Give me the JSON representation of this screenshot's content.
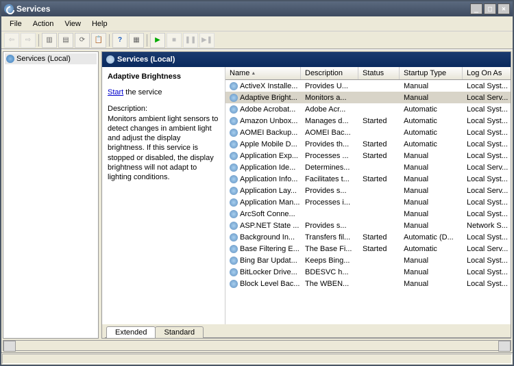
{
  "window": {
    "title": "Services"
  },
  "menu": [
    "File",
    "Action",
    "View",
    "Help"
  ],
  "tree": {
    "root": "Services (Local)"
  },
  "panel": {
    "title": "Services (Local)"
  },
  "detail": {
    "name": "Adaptive Brightness",
    "action_link": "Start",
    "action_rest": " the service",
    "desc_label": "Description:",
    "description": "Monitors ambient light sensors to detect changes in ambient light and adjust the display brightness.  If this service is stopped or disabled, the display brightness will not adapt to lighting conditions."
  },
  "columns": [
    "Name",
    "Description",
    "Status",
    "Startup Type",
    "Log On As"
  ],
  "rows": [
    {
      "n": "ActiveX Installe...",
      "d": "Provides U...",
      "s": "",
      "t": "Manual",
      "l": "Local Syst..."
    },
    {
      "n": "Adaptive Bright...",
      "d": "Monitors a...",
      "s": "",
      "t": "Manual",
      "l": "Local Serv...",
      "sel": true
    },
    {
      "n": "Adobe Acrobat...",
      "d": "Adobe Acr...",
      "s": "",
      "t": "Automatic",
      "l": "Local Syst..."
    },
    {
      "n": "Amazon Unbox...",
      "d": "Manages d...",
      "s": "Started",
      "t": "Automatic",
      "l": "Local Syst..."
    },
    {
      "n": "AOMEI Backup...",
      "d": "AOMEI Bac...",
      "s": "",
      "t": "Automatic",
      "l": "Local Syst..."
    },
    {
      "n": "Apple Mobile D...",
      "d": "Provides th...",
      "s": "Started",
      "t": "Automatic",
      "l": "Local Syst..."
    },
    {
      "n": "Application Exp...",
      "d": "Processes ...",
      "s": "Started",
      "t": "Manual",
      "l": "Local Syst..."
    },
    {
      "n": "Application Ide...",
      "d": "Determines...",
      "s": "",
      "t": "Manual",
      "l": "Local Serv..."
    },
    {
      "n": "Application Info...",
      "d": "Facilitates t...",
      "s": "Started",
      "t": "Manual",
      "l": "Local Syst..."
    },
    {
      "n": "Application Lay...",
      "d": "Provides s...",
      "s": "",
      "t": "Manual",
      "l": "Local Serv..."
    },
    {
      "n": "Application Man...",
      "d": "Processes i...",
      "s": "",
      "t": "Manual",
      "l": "Local Syst..."
    },
    {
      "n": "ArcSoft Conne...",
      "d": "",
      "s": "",
      "t": "Manual",
      "l": "Local Syst..."
    },
    {
      "n": "ASP.NET State ...",
      "d": "Provides s...",
      "s": "",
      "t": "Manual",
      "l": "Network S..."
    },
    {
      "n": "Background In...",
      "d": "Transfers fil...",
      "s": "Started",
      "t": "Automatic (D...",
      "l": "Local Syst..."
    },
    {
      "n": "Base Filtering E...",
      "d": "The Base Fi...",
      "s": "Started",
      "t": "Automatic",
      "l": "Local Serv..."
    },
    {
      "n": "Bing Bar Updat...",
      "d": "Keeps Bing...",
      "s": "",
      "t": "Manual",
      "l": "Local Syst..."
    },
    {
      "n": "BitLocker Drive...",
      "d": "BDESVC h...",
      "s": "",
      "t": "Manual",
      "l": "Local Syst..."
    },
    {
      "n": "Block Level Bac...",
      "d": "The WBEN...",
      "s": "",
      "t": "Manual",
      "l": "Local Syst..."
    }
  ],
  "tabs": [
    "Extended",
    "Standard"
  ]
}
